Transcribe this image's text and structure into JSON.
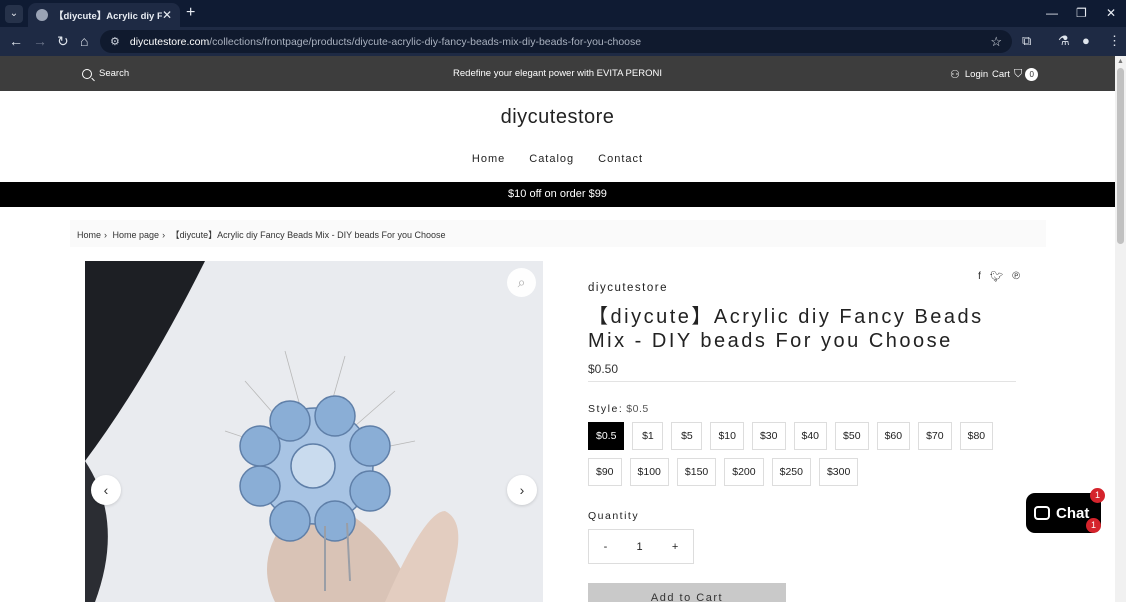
{
  "browser": {
    "tab_title": "【diycute】Acrylic diy Fancy Beads Mix - DIY beads For you Choose",
    "url_host": "diycutestore.com",
    "url_path": "/collections/frontpage/products/diycute-acrylic-diy-fancy-beads-mix-diy-beads-for-you-choose"
  },
  "header": {
    "search_label": "Search",
    "promo_text": "Redefine your elegant power with EVITA PERONI",
    "login_label": "Login",
    "cart_label": "Cart",
    "cart_count": "0"
  },
  "store": {
    "logo_text": "diycutestore",
    "nav": [
      "Home",
      "Catalog",
      "Contact"
    ],
    "offer_text": "$10 off on order $99"
  },
  "breadcrumb": [
    "Home",
    "Home page",
    "【diycute】Acrylic diy Fancy Beads Mix - DIY beads For you Choose"
  ],
  "product": {
    "vendor": "diycutestore",
    "title": "【diycute】Acrylic diy Fancy Beads Mix - DIY beads For you Choose",
    "price": "$0.50",
    "style_label": "Style:",
    "style_selected": "$0.5",
    "styles": [
      "$0.5",
      "$1",
      "$5",
      "$10",
      "$30",
      "$40",
      "$50",
      "$60",
      "$70",
      "$80",
      "$90",
      "$100",
      "$150",
      "$200",
      "$250",
      "$300"
    ],
    "quantity_label": "Quantity",
    "quantity_minus": "-",
    "quantity_value": "1",
    "quantity_plus": "+",
    "add_to_cart": "Add to Cart"
  },
  "chat": {
    "label": "Chat",
    "badge_count": "1",
    "badge_count_2": "1"
  },
  "colors": {
    "announcement_bg": "#3d3d3d",
    "offer_bar_bg": "#000000",
    "selected_swatch_bg": "#000000",
    "badge_red": "#d5242c",
    "browser_chrome": "#1e2a44"
  }
}
